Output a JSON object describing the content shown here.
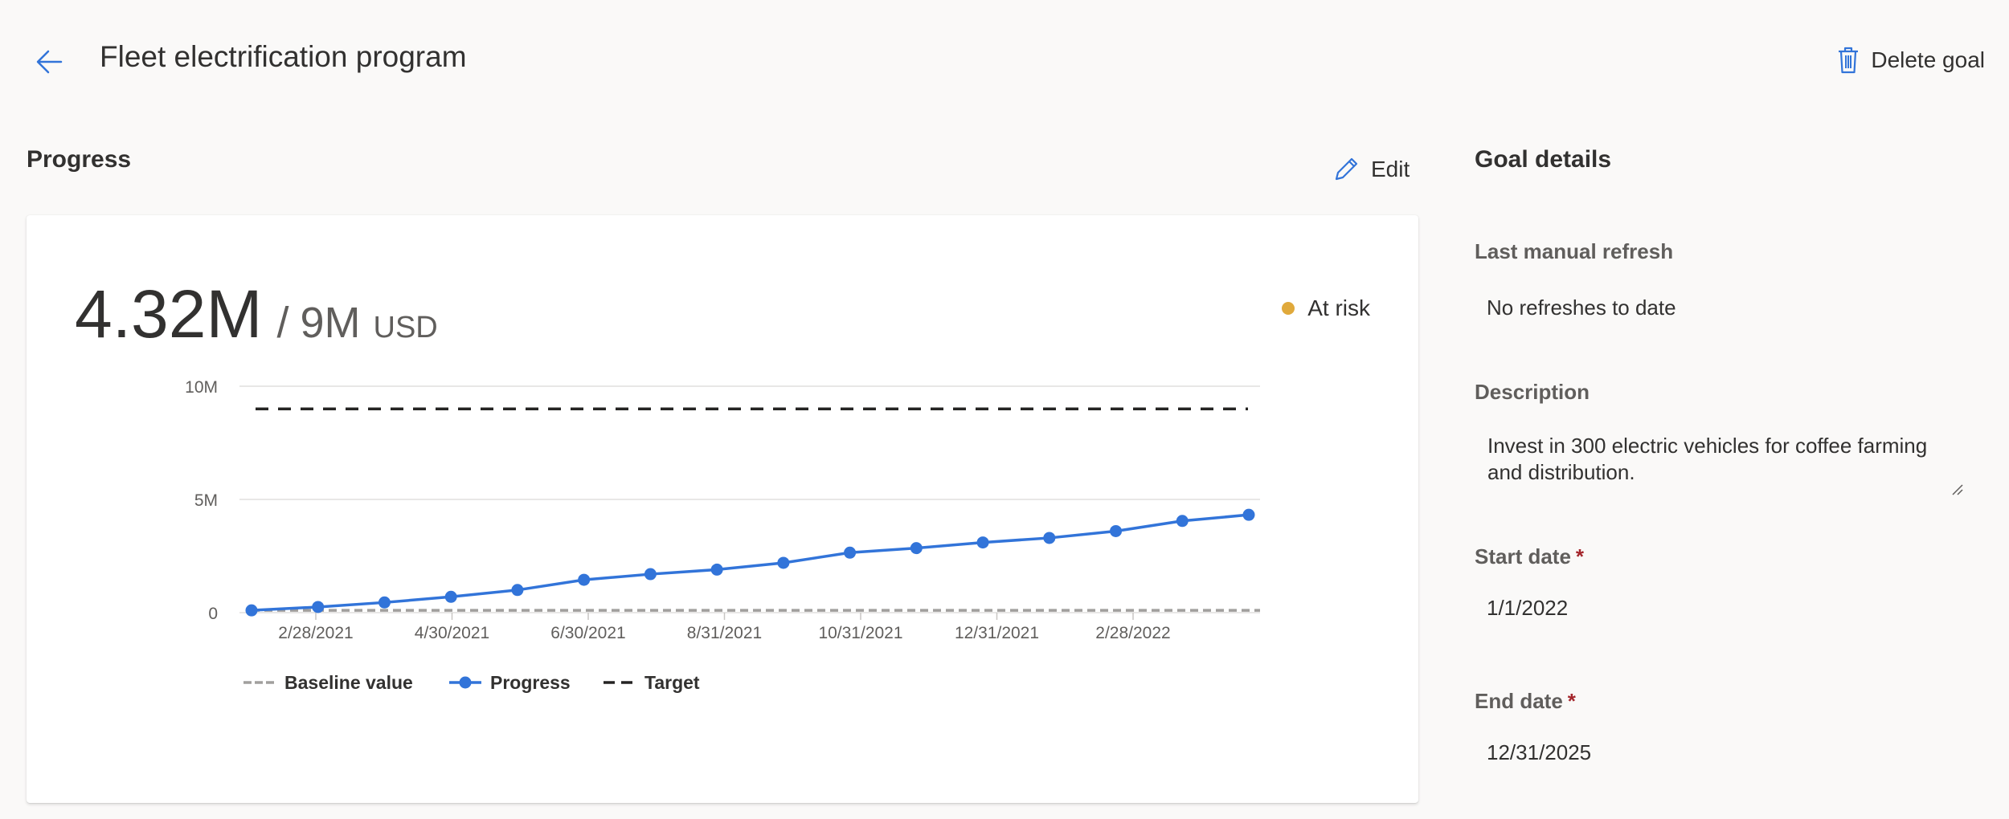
{
  "header": {
    "title": "Fleet electrification program",
    "delete_label": "Delete goal"
  },
  "progress": {
    "heading": "Progress",
    "edit_label": "Edit",
    "current": "4.32M",
    "separator": "/",
    "target": "9M",
    "unit": "USD",
    "status": "At risk",
    "status_color": "#e0a93b"
  },
  "chart_data": {
    "type": "line",
    "x_ticks": [
      "2/28/2021",
      "4/30/2021",
      "6/30/2021",
      "8/31/2021",
      "10/31/2021",
      "12/31/2021",
      "2/28/2022"
    ],
    "y_ticks": [
      "0",
      "5M",
      "10M"
    ],
    "ylim": [
      0,
      10
    ],
    "y_unit": "M",
    "grid": true,
    "legend_position": "bottom-left",
    "series": [
      {
        "name": "Baseline value",
        "style": "dashed",
        "color": "#a19f9d",
        "values": [
          0.1,
          0.1
        ]
      },
      {
        "name": "Progress",
        "style": "solid-markers",
        "color": "#3274d9",
        "values": [
          0.1,
          0.25,
          0.45,
          0.7,
          1.0,
          1.45,
          1.7,
          1.9,
          2.2,
          2.65,
          2.85,
          3.1,
          3.3,
          3.6,
          4.05,
          4.32
        ]
      },
      {
        "name": "Target",
        "style": "dashed",
        "color": "#252423",
        "values": [
          9,
          9
        ]
      }
    ]
  },
  "details": {
    "heading": "Goal details",
    "last_refresh_label": "Last manual refresh",
    "last_refresh_value": "No refreshes to date",
    "description_label": "Description",
    "description_value": "Invest in 300 electric vehicles for coffee farming and distribution.",
    "start_label": "Start date",
    "start_value": "1/1/2022",
    "end_label": "End date",
    "end_value": "12/31/2025",
    "required_mark": "*"
  }
}
